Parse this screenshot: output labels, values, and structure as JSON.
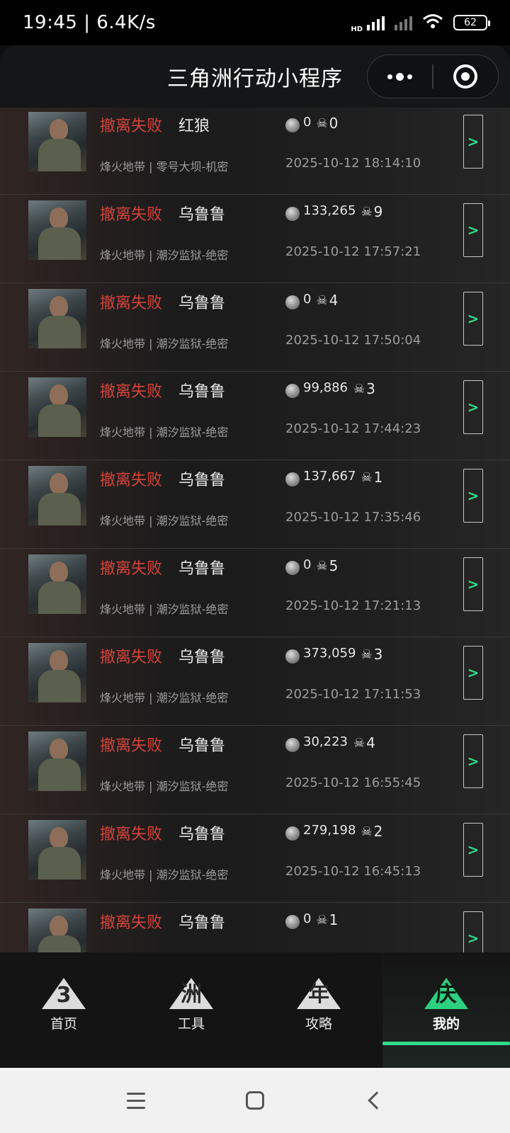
{
  "status_bar": {
    "time_speed": "19:45 | 6.4K/s",
    "hd_label": "HD",
    "battery": "62"
  },
  "header": {
    "title": "三角洲行动小程序"
  },
  "records": [
    {
      "status": "撤离失败",
      "player": "红狼",
      "coins": "0",
      "kills": "0",
      "mode_map": "烽火地带 | 零号大坝-机密",
      "time": "2025-10-12 18:14:10"
    },
    {
      "status": "撤离失败",
      "player": "乌鲁鲁",
      "coins": "133,265",
      "kills": "9",
      "mode_map": "烽火地带 | 潮汐监狱-绝密",
      "time": "2025-10-12 17:57:21"
    },
    {
      "status": "撤离失败",
      "player": "乌鲁鲁",
      "coins": "0",
      "kills": "4",
      "mode_map": "烽火地带 | 潮汐监狱-绝密",
      "time": "2025-10-12 17:50:04"
    },
    {
      "status": "撤离失败",
      "player": "乌鲁鲁",
      "coins": "99,886",
      "kills": "3",
      "mode_map": "烽火地带 | 潮汐监狱-绝密",
      "time": "2025-10-12 17:44:23"
    },
    {
      "status": "撤离失败",
      "player": "乌鲁鲁",
      "coins": "137,667",
      "kills": "1",
      "mode_map": "烽火地带 | 潮汐监狱-绝密",
      "time": "2025-10-12 17:35:46"
    },
    {
      "status": "撤离失败",
      "player": "乌鲁鲁",
      "coins": "0",
      "kills": "5",
      "mode_map": "烽火地带 | 潮汐监狱-绝密",
      "time": "2025-10-12 17:21:13"
    },
    {
      "status": "撤离失败",
      "player": "乌鲁鲁",
      "coins": "373,059",
      "kills": "3",
      "mode_map": "烽火地带 | 潮汐监狱-绝密",
      "time": "2025-10-12 17:11:53"
    },
    {
      "status": "撤离失败",
      "player": "乌鲁鲁",
      "coins": "30,223",
      "kills": "4",
      "mode_map": "烽火地带 | 潮汐监狱-绝密",
      "time": "2025-10-12 16:55:45"
    },
    {
      "status": "撤离失败",
      "player": "乌鲁鲁",
      "coins": "279,198",
      "kills": "2",
      "mode_map": "烽火地带 | 潮汐监狱-绝密",
      "time": "2025-10-12 16:45:13"
    },
    {
      "status": "撤离失败",
      "player": "乌鲁鲁",
      "coins": "0",
      "kills": "1",
      "mode_map": "",
      "time": ""
    }
  ],
  "tabs": [
    {
      "label": "首页",
      "glyph": "3",
      "active": false
    },
    {
      "label": "工具",
      "glyph": "洲",
      "active": false
    },
    {
      "label": "攻略",
      "glyph": "年",
      "active": false
    },
    {
      "label": "我的",
      "glyph": "庆",
      "active": true
    }
  ],
  "colors": {
    "fail_red": "#d6433a",
    "accent_green": "#2fd98a"
  }
}
